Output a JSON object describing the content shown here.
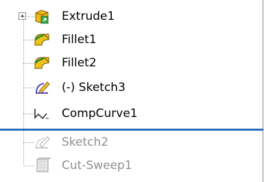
{
  "tree": {
    "items": [
      {
        "label": "Extrude1",
        "icon": "extrude-icon",
        "expandable": true,
        "suppressed": false
      },
      {
        "label": "Fillet1",
        "icon": "fillet-icon",
        "expandable": false,
        "suppressed": false
      },
      {
        "label": "Fillet2",
        "icon": "fillet-icon",
        "expandable": false,
        "suppressed": false
      },
      {
        "label": "(-) Sketch3",
        "icon": "sketch-icon",
        "expandable": false,
        "suppressed": false
      },
      {
        "label": "CompCurve1",
        "icon": "composite-curve-icon",
        "expandable": false,
        "suppressed": false
      },
      {
        "label": "Sketch2",
        "icon": "sketch-icon",
        "expandable": false,
        "suppressed": true
      },
      {
        "label": "Cut-Sweep1",
        "icon": "cut-sweep-icon",
        "expandable": false,
        "suppressed": true
      }
    ],
    "rollback_bar_color": "#2a6ebf"
  }
}
